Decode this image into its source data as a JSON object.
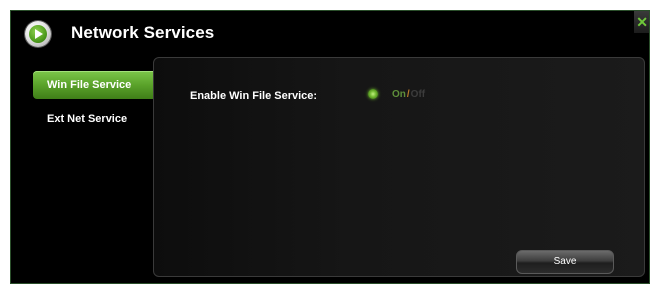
{
  "window": {
    "title": "Network Services",
    "title_icon": "play-circle-icon",
    "close_icon": "close-icon",
    "close_label": "✕"
  },
  "sidebar": {
    "items": [
      {
        "label": "Win File Service",
        "active": true
      },
      {
        "label": "Ext Net Service",
        "active": false
      }
    ]
  },
  "panel": {
    "setting_label": "Enable Win File Service:",
    "toggle": {
      "on_label": "On",
      "separator": "/",
      "off_label": "Off",
      "selected": "On"
    },
    "save_label": "Save"
  },
  "colors": {
    "accent_green": "#5aa22a",
    "background": "#000000",
    "toggle_separator": "#b77a2a"
  }
}
